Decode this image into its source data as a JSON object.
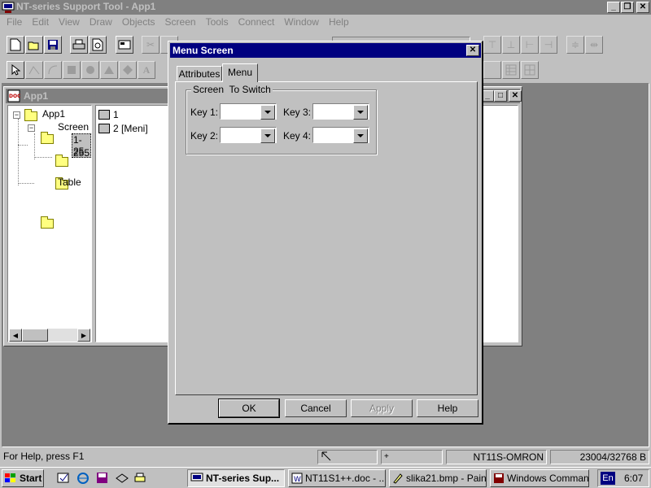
{
  "app": {
    "title": "NT-series Support Tool - App1"
  },
  "menu": [
    "File",
    "Edit",
    "View",
    "Draw",
    "Objects",
    "Screen",
    "Tools",
    "Connect",
    "Window",
    "Help"
  ],
  "child_window": {
    "title": "App1",
    "tree": {
      "root": "App1",
      "screen": "Screen",
      "item1": "1-25",
      "item2": "255",
      "table": "Table"
    },
    "list": [
      "1",
      "2 [Meni]"
    ]
  },
  "dialog": {
    "title": "Menu Screen",
    "tabs": [
      "Attributes",
      "Menu"
    ],
    "group_label": "Screen  To Switch",
    "keys": [
      "Key 1:",
      "Key 2:",
      "Key 3:",
      "Key 4:"
    ],
    "buttons": {
      "ok": "OK",
      "cancel": "Cancel",
      "apply": "Apply",
      "help": "Help"
    }
  },
  "statusbar": {
    "help": "For Help, press F1",
    "model": "NT11S-OMRON",
    "memory": "23004/32768 B"
  },
  "taskbar": {
    "start": "Start",
    "tasks": [
      "NT-series Sup...",
      "NT11S1++.doc - ...",
      "slika21.bmp - Paint",
      "Windows Comman..."
    ],
    "lang": "En",
    "clock": "6:07"
  },
  "colors": {
    "title_active": "#000080",
    "title_inactive": "#808080",
    "face": "#c0c0c0",
    "workspace": "#808080"
  }
}
